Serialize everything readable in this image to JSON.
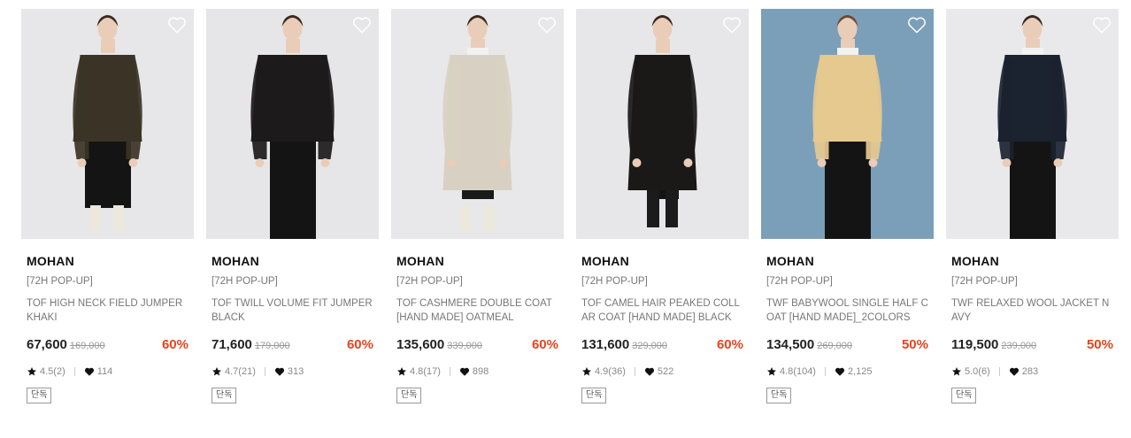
{
  "products": [
    {
      "brand": "MOHAN",
      "tag": "[72H POP-UP]",
      "name": "TOF HIGH NECK FIELD JUMPER KHAKI",
      "price": "67,600",
      "original_price": "169,000",
      "discount": "60%",
      "rating": "4.5(2)",
      "likes": "114",
      "badge": "단독",
      "bg_color": "#e7e7e9",
      "garment_color": "#3b3426",
      "icon": "heart-outline-icon"
    },
    {
      "brand": "MOHAN",
      "tag": "[72H POP-UP]",
      "name": "TOF TWILL VOLUME FIT JUMPER BLACK",
      "price": "71,600",
      "original_price": "179,000",
      "discount": "60%",
      "rating": "4.7(21)",
      "likes": "313",
      "badge": "단독",
      "bg_color": "#e6e6e8",
      "garment_color": "#1c1a1a",
      "icon": "heart-outline-icon"
    },
    {
      "brand": "MOHAN",
      "tag": "[72H POP-UP]",
      "name": "TOF CASHMERE DOUBLE COAT [HAND MADE] OATMEAL",
      "price": "135,600",
      "original_price": "339,000",
      "discount": "60%",
      "rating": "4.8(17)",
      "likes": "898",
      "badge": "단독",
      "bg_color": "#e8e8ea",
      "garment_color": "#d8d1c3",
      "icon": "heart-outline-icon"
    },
    {
      "brand": "MOHAN",
      "tag": "[72H POP-UP]",
      "name": "TOF CAMEL HAIR PEAKED COLLAR COAT [HAND MADE] BLACK",
      "price": "131,600",
      "original_price": "329,000",
      "discount": "60%",
      "rating": "4.9(36)",
      "likes": "522",
      "badge": "단독",
      "bg_color": "#e7e7e9",
      "garment_color": "#1a1918",
      "icon": "heart-outline-icon"
    },
    {
      "brand": "MOHAN",
      "tag": "[72H POP-UP]",
      "name": "TWF BABYWOOL SINGLE HALF COAT [HAND MADE]_2COLORS",
      "price": "134,500",
      "original_price": "269,000",
      "discount": "50%",
      "rating": "4.8(104)",
      "likes": "2,125",
      "badge": "단독",
      "bg_color": "#7c9fb9",
      "garment_color": "#e5c98f",
      "icon": "heart-outline-icon"
    },
    {
      "brand": "MOHAN",
      "tag": "[72H POP-UP]",
      "name": "TWF RELAXED WOOL JACKET NAVY",
      "price": "119,500",
      "original_price": "239,000",
      "discount": "50%",
      "rating": "5.0(6)",
      "likes": "283",
      "badge": "단독",
      "bg_color": "#e9e9eb",
      "garment_color": "#1b2230",
      "icon": "heart-outline-icon"
    }
  ],
  "colors": {
    "discount": "#e8431e",
    "text": "#222222",
    "muted": "#777777"
  }
}
